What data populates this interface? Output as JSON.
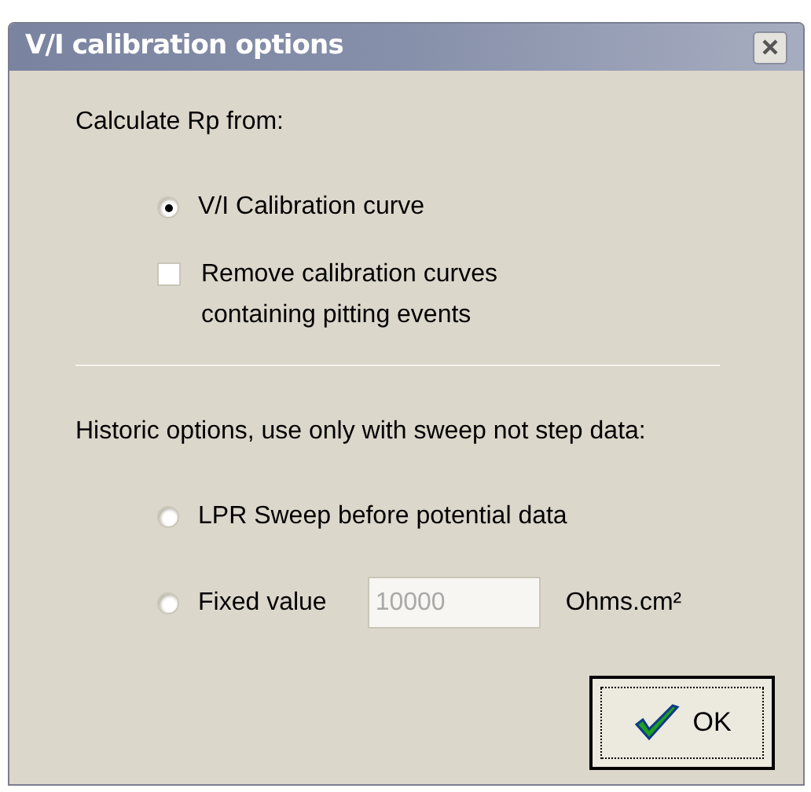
{
  "window": {
    "title": "V/I calibration options"
  },
  "calculate": {
    "heading": "Calculate Rp from:",
    "options": [
      {
        "kind": "radio",
        "label": "V/I Calibration curve",
        "selected": true
      },
      {
        "kind": "checkbox",
        "label": "Remove calibration curves containing pitting events",
        "checked": false
      }
    ]
  },
  "historic": {
    "heading": "Historic options, use only with sweep not step data:",
    "options": [
      {
        "label": "LPR Sweep before potential data",
        "selected": false
      },
      {
        "label": "Fixed value",
        "selected": false,
        "field": {
          "value": "10000",
          "disabled": true,
          "unit": "Ohms.cm²"
        }
      }
    ]
  },
  "buttons": [
    {
      "label": "OK",
      "focused": true
    }
  ]
}
